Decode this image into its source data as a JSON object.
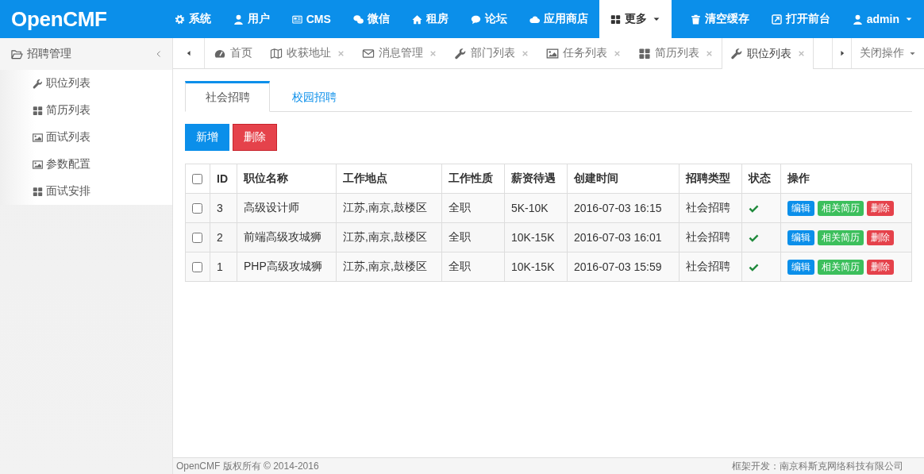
{
  "header": {
    "logo": "OpenCMF",
    "nav": [
      {
        "label": "系统",
        "selected": false,
        "dropdown": false
      },
      {
        "label": "用户",
        "selected": false,
        "dropdown": false
      },
      {
        "label": "CMS",
        "selected": false,
        "dropdown": false
      },
      {
        "label": "微信",
        "selected": false,
        "dropdown": false
      },
      {
        "label": "租房",
        "selected": false,
        "dropdown": false
      },
      {
        "label": "论坛",
        "selected": false,
        "dropdown": false
      },
      {
        "label": "应用商店",
        "selected": false,
        "dropdown": false
      },
      {
        "label": "更多",
        "selected": true,
        "dropdown": true
      }
    ],
    "right_nav": [
      {
        "label": "清空缓存",
        "dropdown": false
      },
      {
        "label": "打开前台",
        "dropdown": false
      },
      {
        "label": "admin",
        "dropdown": true
      }
    ]
  },
  "sidebar": {
    "group": {
      "label": "招聘管理",
      "expanded": true
    },
    "items": [
      {
        "label": "职位列表",
        "selected": false
      },
      {
        "label": "简历列表",
        "selected": false
      },
      {
        "label": "面试列表",
        "selected": false
      },
      {
        "label": "参数配置",
        "selected": false
      },
      {
        "label": "面试安排",
        "selected": false
      }
    ]
  },
  "page_tabs": {
    "items": [
      {
        "label": "首页",
        "closable": false,
        "selected": false
      },
      {
        "label": "收获地址",
        "closable": true,
        "selected": false
      },
      {
        "label": "消息管理",
        "closable": true,
        "selected": false
      },
      {
        "label": "部门列表",
        "closable": true,
        "selected": false
      },
      {
        "label": "任务列表",
        "closable": true,
        "selected": false
      },
      {
        "label": "简历列表",
        "closable": true,
        "selected": false
      },
      {
        "label": "职位列表",
        "closable": true,
        "selected": true
      }
    ],
    "menu": "关闭操作"
  },
  "content": {
    "tabs": [
      {
        "label": "社会招聘",
        "selected": true
      },
      {
        "label": "校园招聘",
        "selected": false
      }
    ],
    "buttons": [
      {
        "label": "新增",
        "kind": "primary"
      },
      {
        "label": "删除",
        "kind": "danger"
      }
    ],
    "table": {
      "select_all": false,
      "columns": [
        "ID",
        "职位名称",
        "工作地点",
        "工作性质",
        "薪资待遇",
        "创建时间",
        "招聘类型",
        "状态",
        "操作"
      ],
      "rows": [
        {
          "checked": false,
          "cells": [
            "3",
            "高级设计师",
            "江苏,南京,鼓楼区",
            "全职",
            "5K-10K",
            "2016-07-03 16:15",
            "社会招聘"
          ],
          "active": true,
          "actions": [
            {
              "label": "编辑",
              "kind": "primary"
            },
            {
              "label": "相关简历",
              "kind": "success"
            },
            {
              "label": "删除",
              "kind": "danger"
            }
          ]
        },
        {
          "checked": false,
          "cells": [
            "2",
            "前端高级攻城狮",
            "江苏,南京,鼓楼区",
            "全职",
            "10K-15K",
            "2016-07-03 16:01",
            "社会招聘"
          ],
          "active": true,
          "actions": [
            {
              "label": "编辑",
              "kind": "primary"
            },
            {
              "label": "相关简历",
              "kind": "success"
            },
            {
              "label": "删除",
              "kind": "danger"
            }
          ]
        },
        {
          "checked": false,
          "cells": [
            "1",
            "PHP高级攻城狮",
            "江苏,南京,鼓楼区",
            "全职",
            "10K-15K",
            "2016-07-03 15:59",
            "社会招聘"
          ],
          "active": true,
          "actions": [
            {
              "label": "编辑",
              "kind": "primary"
            },
            {
              "label": "相关简历",
              "kind": "success"
            },
            {
              "label": "删除",
              "kind": "danger"
            }
          ]
        }
      ]
    }
  },
  "footer": {
    "copyright": "OpenCMF 版权所有 © 2014-2016",
    "credit": "框架开发：南京科斯克网络科技有限公司"
  }
}
